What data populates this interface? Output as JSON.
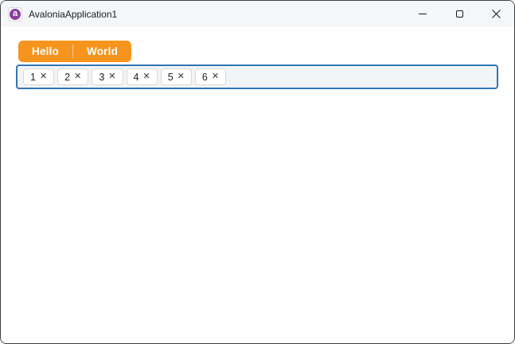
{
  "titlebar": {
    "title": "AvaloniaApplication1",
    "app_icon": {
      "name": "avalonia-logo",
      "letter": "a"
    },
    "controls": [
      {
        "name": "minimize"
      },
      {
        "name": "maximize"
      },
      {
        "name": "close"
      }
    ]
  },
  "toolbar": {
    "split_button": {
      "segments": [
        {
          "label": "Hello"
        },
        {
          "label": "World"
        }
      ]
    }
  },
  "tag_box": {
    "chips": [
      {
        "label": "1"
      },
      {
        "label": "2"
      },
      {
        "label": "3"
      },
      {
        "label": "4"
      },
      {
        "label": "5"
      },
      {
        "label": "6"
      }
    ],
    "remove_glyph": "✕"
  },
  "colors": {
    "accent_orange": "#F7941D",
    "focus_border_blue": "#3077B4",
    "icon_purple": "#8B3D9E",
    "titlebar_bg": "#F4F6F8",
    "window_border": "#3D3D3F"
  }
}
